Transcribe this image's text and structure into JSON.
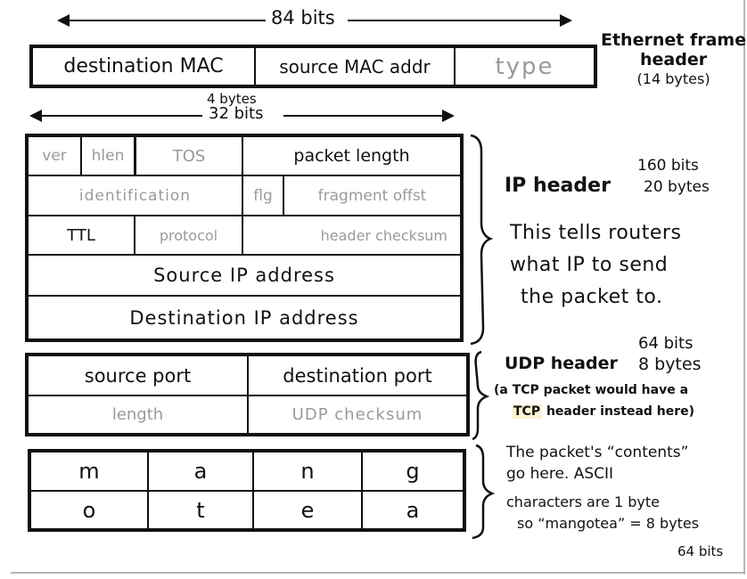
{
  "ethernet": {
    "width_label": "84 bits",
    "fields": [
      {
        "label": "destination MAC",
        "style": "dark"
      },
      {
        "label": "source MAC addr",
        "style": "dark"
      },
      {
        "label": "type",
        "style": "grey"
      }
    ],
    "annotation": [
      "Ethernet frame",
      "header",
      "(14 bytes)"
    ]
  },
  "word_width": {
    "bytes_label": "4  bytes",
    "bits_label": "32 bits"
  },
  "ip_header": {
    "rows": [
      [
        {
          "label": "ver",
          "style": "grey"
        },
        {
          "label": "hlen",
          "style": "grey"
        },
        {
          "label": "TOS",
          "style": "grey"
        },
        {
          "label": "packet length",
          "style": "dark"
        }
      ],
      [
        {
          "label": "identification",
          "style": "grey"
        },
        {
          "label": "flg",
          "style": "grey"
        },
        {
          "label": "fragment offst",
          "style": "grey"
        }
      ],
      [
        {
          "label": "TTL",
          "style": "dark"
        },
        {
          "label": "protocol",
          "style": "grey"
        },
        {
          "label": "header checksum",
          "style": "grey"
        }
      ],
      [
        {
          "label": "Source IP address",
          "style": "dark"
        }
      ],
      [
        {
          "label": "Destination IP address",
          "style": "dark"
        }
      ]
    ],
    "title": "IP header",
    "size_bits": "160 bits",
    "size_bytes": "20 bytes",
    "description": [
      "This tells routers",
      "what IP to send",
      "the packet to."
    ]
  },
  "udp_header": {
    "rows": [
      [
        {
          "label": "source port",
          "style": "dark"
        },
        {
          "label": "destination port",
          "style": "dark"
        }
      ],
      [
        {
          "label": "length",
          "style": "grey"
        },
        {
          "label": "UDP checksum",
          "style": "grey"
        }
      ]
    ],
    "title": "UDP header",
    "size_bits": "64 bits",
    "size_bytes": "8 bytes",
    "note_line1": "(a TCP packet would have a",
    "note_highlight": "TCP",
    "note_line2_rest": " header instead here)",
    "highlight_color": "#fbf3d0"
  },
  "payload": {
    "rows": [
      [
        "m",
        "a",
        "n",
        "g"
      ],
      [
        "o",
        "t",
        "e",
        "a"
      ]
    ],
    "description": [
      "The packet's “contents”",
      "go here. ASCII",
      "characters are 1 byte",
      "so “mangotea” = 8 bytes"
    ],
    "size_bits": "64 bits"
  }
}
